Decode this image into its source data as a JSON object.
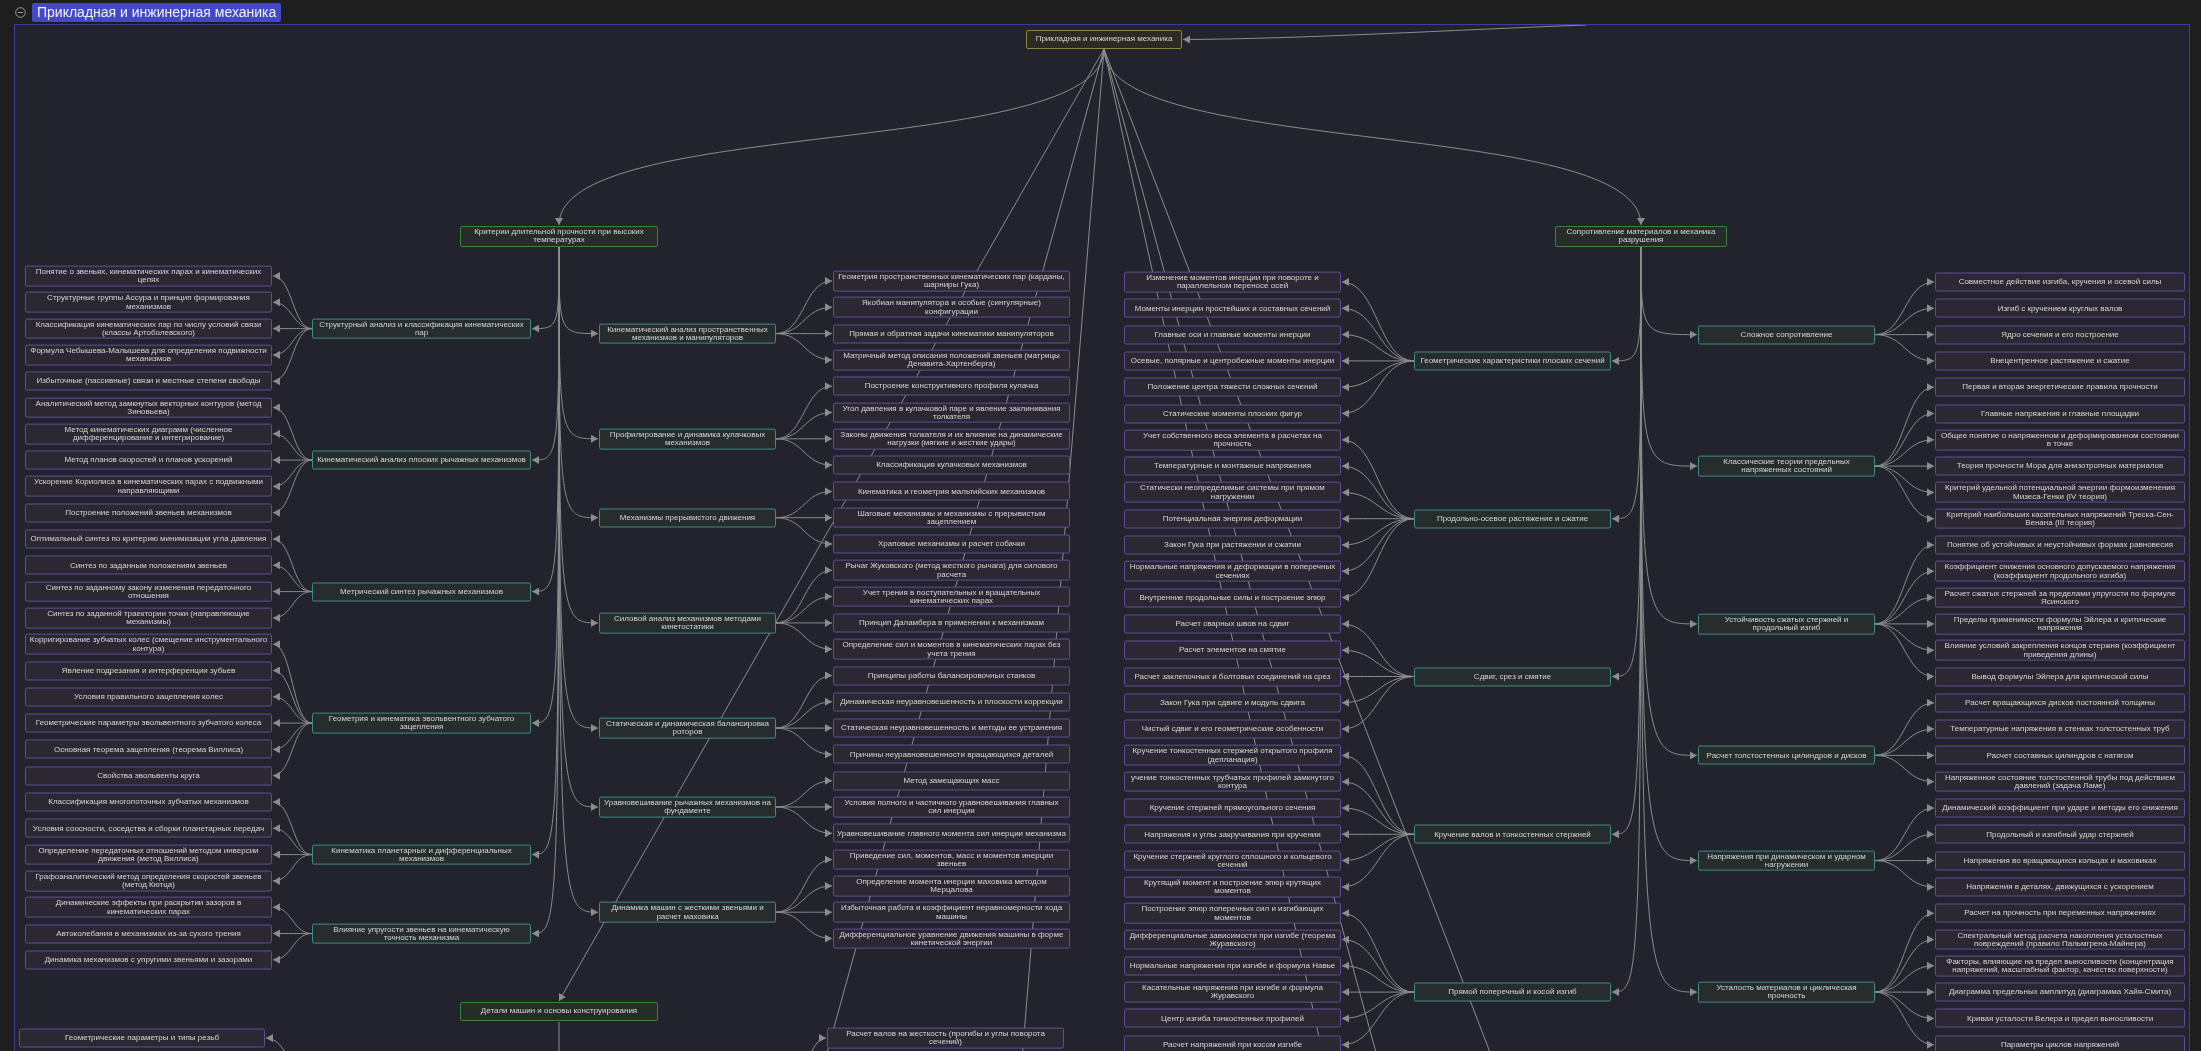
{
  "title": "Прикладная и инжинерная механика",
  "root": {
    "label": "Прикладная и инжинерная механика"
  },
  "branches": [
    {
      "label": "Критерии длительной прочности при высоких температурах",
      "left_groups": [
        {
          "label": "Структурный анализ и классификация кинематических пар",
          "items": [
            "Понятие о звеньях, кинематических парах и кинематических цепях",
            "Структурные группы Ассура и принцип формирования механизмов",
            "Классификация кинематических пар по числу условий связи (классы Артоболевского)",
            "Формула Чебышева-Малышева для определения подвижности механизмов",
            "Избыточные (пассивные) связи и местные степени свободы"
          ]
        },
        {
          "label": "Кинематический анализ плоских рычажных механизмов",
          "items": [
            "Аналитический метод замкнутых векторных контуров (метод Зиновьева)",
            "Метод кинематических диаграмм (численное дифференцирование и интегрирование)",
            "Метод планов скоростей и планов ускорений",
            "Ускорение Кориолиса в кинематических парах с подвижными направляющими",
            "Построение положений звеньев механизмов"
          ]
        },
        {
          "label": "Метрический синтез рычажных механизмов",
          "items": [
            "Оптимальный синтез по критерию минимизации угла давления",
            "Синтез по заданным положениям звеньев",
            "Синтез по заданному закону изменения передаточного отношения",
            "Синтез по заданной траектории точки (направляющие механизмы)"
          ]
        },
        {
          "label": "Геометрия и кинематика эвольвентного зубчатого зацепления",
          "items": [
            "Корригирование зубчатых колес (смещение инструментального контура)",
            "Явление подрезания и интерференции зубьев",
            "Условия правильного зацепления колес",
            "Геометрические параметры эвольвентного зубчатого колеса",
            "Основная теорема зацепления (теорема Виллиса)",
            "Свойства эвольвенты круга"
          ]
        },
        {
          "label": "Кинематика планетарных и дифференциальных механизмов",
          "items": [
            "Классификация многопоточных зубчатых механизмов",
            "Условия соосности, соседства и сборки планетарных передач",
            "Определение передаточных отношений методом инверсии движения (метод Виллиса)",
            "Графоаналитический метод определения скоростей звеньев (метод Кютца)"
          ]
        },
        {
          "label": "Влияние упругости звеньев на кинематическую точность механизма",
          "items": [
            "Динамические эффекты при раскрытии зазоров в кинематических парах",
            "Автоколебания в механизмах из-за сухого трения",
            "Динамика механизмов с упругими звеньями и зазорами"
          ]
        }
      ],
      "right_groups": [
        {
          "label": "Кинематический анализ пространственных механизмов и манипуляторов",
          "items": [
            "Геометрия пространственных кинематических пар (карданы, шарниры Гука)",
            "Якобиан манипулятора и особые (сингулярные) конфигурации",
            "Прямая и обратная задачи кинематики манипуляторов",
            "Матричный метод описания положений звеньев (матрицы Денавита-Хартенберга)"
          ]
        },
        {
          "label": "Профилирование и динамика кулачковых механизмов",
          "items": [
            "Построение конструктивного профиля кулачка",
            "Угол давления в кулачковой паре и явление заклинивания толкателя",
            "Законы движения толкателя и их влияние на динамические нагрузки (мягкие и жесткие удары)",
            "Классификация кулачковых механизмов"
          ]
        },
        {
          "label": "Механизмы прерывистого движения",
          "items": [
            "Кинематика и геометрия мальтийских механизмов",
            "Шаговые механизмы и механизмы с прерывистым зацеплением",
            "Храповые механизмы и расчет собачки"
          ]
        },
        {
          "label": "Силовой анализ механизмов методами кинетостатики",
          "items": [
            "Рычаг Жуковского (метод жесткого рычага) для силового расчета",
            "Учет трения в поступательных и вращательных кинематических парах",
            "Принцип Даламбера в применении к механизмам",
            "Определение сил и моментов в кинематических парах без учета трения"
          ]
        },
        {
          "label": "Статическая и динамическая балансировка роторов",
          "items": [
            "Принципы работы балансировочных станков",
            "Динамическая неуравновешенность и плоскости коррекции",
            "Статическая неуравновешенность и методы ее устранения",
            "Причины неуравновешенности вращающихся деталей"
          ]
        },
        {
          "label": "Уравновешивание рычажных механизмов на фундаменте",
          "items": [
            "Метод замещающих масс",
            "Условия полного и частичного уравновешивания главных сил инерции",
            "Уравновешивание главного момента сил инерции механизма"
          ]
        },
        {
          "label": "Динамика машин с жесткими звеньями и расчет маховика",
          "items": [
            "Приведение сил, моментов, масс и моментов инерции звеньев",
            "Определение момента инерции маховика методом Мерцалова",
            "Избыточная работа и коэффициент неравномерности хода машины",
            "Дифференциальное уравнение движения машины в форме кинетической энергии"
          ]
        }
      ]
    },
    {
      "label": "Детали машин и основы конструирования",
      "left_groups": [
        {
          "items": [
            "Геометрические параметры и типы резьб"
          ]
        }
      ],
      "right_groups": [
        {
          "items": [
            "Расчет валов на жесткость (прогибы и углы поворота сечений)"
          ]
        }
      ]
    },
    {
      "label": "Сопротивление материалов и механика разрушения",
      "left_groups": [
        {
          "label": "Геометрические характеристики плоских сечений",
          "items": [
            "Изменение моментов инерции при повороте и параллельном переносе осей",
            "Моменты инерции простейших и составных сечений",
            "Главные оси и главные моменты инерции",
            "Осевые, полярные и центробежные моменты инерции",
            "Положение центра тяжести сложных сечений",
            "Статические моменты плоских фигур"
          ]
        },
        {
          "label": "Продольно-осевое растяжение и сжатие",
          "items": [
            "Учет собственного веса элемента в расчетах на прочность",
            "Температурные и монтажные напряжения",
            "Статически неопределимые системы при прямом нагружении",
            "Потенциальная энергия деформации",
            "Закон Гука при растяжении и сжатии",
            "Нормальные напряжения и деформации в поперечных сечениях",
            "Внутренние продольные силы и построение эпюр"
          ]
        },
        {
          "label": "Сдвиг, срез и смятие",
          "items": [
            "Расчет сварных швов на сдвиг",
            "Расчет элементов на смятие",
            "Расчет заклепочных и болтовых соединений на срез",
            "Закон Гука при сдвиге и модуль сдвига",
            "Чистый сдвиг и его геометрические особенности"
          ]
        },
        {
          "label": "Кручение валов и тонкостенных стержней",
          "items": [
            "Кручение тонкостенных стержней открытого профиля (депланация)",
            "учение тонкостенных трубчатых профилей замкнутого контура",
            "Кручение стержней прямоугольного сечения",
            "Напряжения и углы закручивания при кручении",
            "Кручение стержней круглого сплошного и кольцевого сечений",
            "Крутящий момент и построение эпюр крутящих моментов"
          ]
        },
        {
          "label": "Прямой поперечный и косой изгиб",
          "items": [
            "Построение эпюр поперечных сил и изгибающих моментов",
            "Дифференциальные зависимости при изгибе (теорема Журавского)",
            "Нормальные напряжения при изгибе и формула Навье",
            "Касательные напряжения при изгибе и формула Журавского",
            "Центр изгиба тонкостенных профилей",
            "Расчет напряжений при косом изгибе"
          ]
        }
      ],
      "right_groups": [
        {
          "label": "Сложное сопротивление",
          "items": [
            "Совместное действие изгиба, кручения и осевой силы",
            "Изгиб с кручением круглых валов",
            "Ядро сечения и его построение",
            "Внецентренное растяжение и сжатие"
          ]
        },
        {
          "label": "Классические теории предельных напряженных состояний",
          "items": [
            "Первая и вторая энергетические правила прочности",
            "Главные напряжения и главные площадки",
            "Общее понятие о напряженном и деформированном состоянии в точке",
            "Теория прочности Мора для анизотропных материалов",
            "Критерий удельной потенциальной энергии формоизменения Мизеса-Генки (IV теория)",
            "Критерий наибольших касательных напряжений Треска-Сен-Венана (III теория)"
          ]
        },
        {
          "label": "Устойчивость сжатых стержней и продольный изгиб",
          "items": [
            "Понятие об устойчивых и неустойчивых формах равновесия",
            "Коэффициент снижения основного допускаемого напряжения (коэффициент продольного изгиба)",
            "Расчет сжатых стержней за пределами упругости по формуле Ясинского",
            "Пределы применимости формулы Эйлера и критические напряжения",
            "Влияние условий закрепления концов стержня (коэффициент приведения длины)",
            "Вывод формулы Эйлера для критической силы"
          ]
        },
        {
          "label": "Расчет толстостенных цилиндров и дисков",
          "items": [
            "Расчет вращающихся дисков постоянной толщины",
            "Температурные напряжения в стенках толстостенных труб",
            "Расчет составных цилиндров с натягом",
            "Напряженное состояние толстостенной трубы под действием давлений (задача Ламе)"
          ]
        },
        {
          "label": "Напряжения при динамическом и ударном нагружении",
          "items": [
            "Динамический коэффициент при ударе и методы его снижения",
            "Продольный и изгибный удар стержней",
            "Напряжения во вращающихся кольцах и маховиках",
            "Напряжения в деталях, движущихся с ускорением"
          ]
        },
        {
          "label": "Усталость материалов и циклическая прочность",
          "items": [
            "Расчет на прочность при переменных напряжениях",
            "Спектральный метод расчета накопления усталостных повреждений (правило Пальмгрена-Майнера)",
            "Факторы, влияющие на предел выносливости (концентрация напряжений, масштабный фактор, качество поверхности)",
            "Диаграмма предельных амплитуд (диаграмма Хайя-Смита)",
            "Кривая усталости Велера и предел выносливости",
            "Параметры циклов напряжений"
          ]
        }
      ]
    }
  ]
}
